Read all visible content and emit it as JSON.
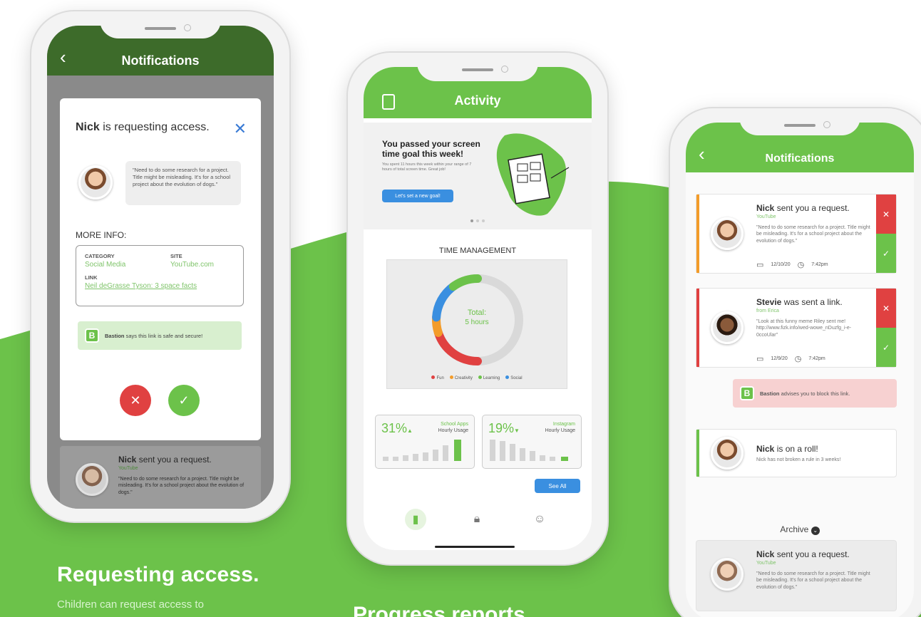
{
  "colors": {
    "brand_green": "#6cc24a",
    "dark_green": "#3d6b2a",
    "danger": "#e04141",
    "info_blue": "#3a8fe0",
    "warning": "#f39c2a"
  },
  "phone1": {
    "header_title": "Notifications",
    "modal": {
      "requester": "Nick",
      "title_rest": "is requesting access.",
      "message": "\"Need to do some research for a project. Title might be misleading. It's for a school project about the evolution of dogs.\"",
      "more_info_label": "MORE INFO:",
      "category_label": "CATEGORY",
      "category_value": "Social Media",
      "site_label": "SITE",
      "site_value": "YouTube.com",
      "link_label": "LINK",
      "link_value": "Neil deGrasse Tyson: 3 space facts",
      "safe_name": "Bastion",
      "safe_rest": "says this link is safe and secure!",
      "logo_letter": "B"
    },
    "bg_card": {
      "name": "Nick",
      "rest": "sent you a request.",
      "source": "YouTube",
      "message": "\"Need to do some research for a project. Title might be misleading. It's for a school project about the evolution of dogs.\""
    }
  },
  "phone2": {
    "header_title": "Activity",
    "banner": {
      "headline": "You passed your screen time goal this week!",
      "detail": "You spent 11 hours this week within your range of 7 hours of total screen time. Great job!",
      "cta": "Let's set a new goal!"
    },
    "section_title": "TIME MANAGEMENT",
    "chart_data": {
      "type": "pie",
      "total_label": "Total:",
      "total_value": "5 hours",
      "series": [
        {
          "name": "Fun",
          "color": "#e04141",
          "value": 0.4
        },
        {
          "name": "Creativity",
          "color": "#f39c2a",
          "value": 0.12
        },
        {
          "name": "Learning",
          "color": "#6cc24a",
          "value": 0.2
        },
        {
          "name": "Social",
          "color": "#3a8fe0",
          "value": 0.28
        }
      ]
    },
    "stats": [
      {
        "pct": "31%",
        "arrow": "▲",
        "app": "School Apps",
        "label": "Hourly Usage"
      },
      {
        "pct": "19%",
        "arrow": "▼",
        "app": "Instagram",
        "label": "Hourly Usage"
      }
    ],
    "see_all": "See All",
    "tabs": [
      "stats-icon",
      "lock-icon",
      "user-icon"
    ]
  },
  "phone3": {
    "header_title": "Notifications",
    "notifications": [
      {
        "name": "Nick",
        "rest": "sent you a request.",
        "source": "YouTube",
        "message": "\"Need to do some research for a project. Title might be misleading. It's for a school project about the evolution of dogs.\"",
        "date": "12/10/20",
        "time": "7:42pm"
      },
      {
        "name": "Stevie",
        "rest": "was sent a link.",
        "source": "from Erica",
        "message": "\"Look at this funny meme Riley sent me! http://www.fizk.info/wed-wowe_nDuzfg_i-e-0ccoUlar\"",
        "date": "12/9/20",
        "time": "7:42pm"
      }
    ],
    "block_notice": {
      "name": "Bastion",
      "rest": "advises you to block this link.",
      "logo_letter": "B"
    },
    "roll": {
      "name": "Nick",
      "rest": "is on a roll!",
      "detail": "Nick has not broken a rule in 3 weeks!"
    },
    "archive_label": "Archive",
    "archived": {
      "name": "Nick",
      "rest": "sent you a request.",
      "source": "YouTube",
      "message": "\"Need to do some research for a project. Title might be misleading. It's for a school project about the evolution of dogs.\""
    }
  },
  "captions": {
    "headline1": "Requesting access.",
    "text1": "Children can request access to",
    "headline2": "Progress reports."
  }
}
